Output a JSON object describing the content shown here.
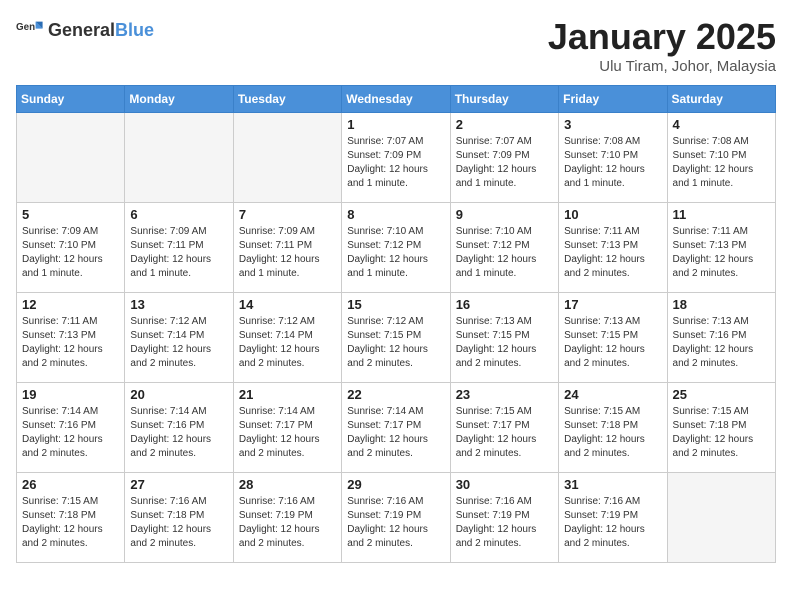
{
  "logo": {
    "text_general": "General",
    "text_blue": "Blue"
  },
  "header": {
    "month_title": "January 2025",
    "location": "Ulu Tiram, Johor, Malaysia"
  },
  "weekdays": [
    "Sunday",
    "Monday",
    "Tuesday",
    "Wednesday",
    "Thursday",
    "Friday",
    "Saturday"
  ],
  "weeks": [
    [
      {
        "day": "",
        "empty": true
      },
      {
        "day": "",
        "empty": true
      },
      {
        "day": "",
        "empty": true
      },
      {
        "day": "1",
        "sunrise": "7:07 AM",
        "sunset": "7:09 PM",
        "daylight": "12 hours and 1 minute."
      },
      {
        "day": "2",
        "sunrise": "7:07 AM",
        "sunset": "7:09 PM",
        "daylight": "12 hours and 1 minute."
      },
      {
        "day": "3",
        "sunrise": "7:08 AM",
        "sunset": "7:10 PM",
        "daylight": "12 hours and 1 minute."
      },
      {
        "day": "4",
        "sunrise": "7:08 AM",
        "sunset": "7:10 PM",
        "daylight": "12 hours and 1 minute."
      }
    ],
    [
      {
        "day": "5",
        "sunrise": "7:09 AM",
        "sunset": "7:10 PM",
        "daylight": "12 hours and 1 minute."
      },
      {
        "day": "6",
        "sunrise": "7:09 AM",
        "sunset": "7:11 PM",
        "daylight": "12 hours and 1 minute."
      },
      {
        "day": "7",
        "sunrise": "7:09 AM",
        "sunset": "7:11 PM",
        "daylight": "12 hours and 1 minute."
      },
      {
        "day": "8",
        "sunrise": "7:10 AM",
        "sunset": "7:12 PM",
        "daylight": "12 hours and 1 minute."
      },
      {
        "day": "9",
        "sunrise": "7:10 AM",
        "sunset": "7:12 PM",
        "daylight": "12 hours and 1 minute."
      },
      {
        "day": "10",
        "sunrise": "7:11 AM",
        "sunset": "7:13 PM",
        "daylight": "12 hours and 2 minutes."
      },
      {
        "day": "11",
        "sunrise": "7:11 AM",
        "sunset": "7:13 PM",
        "daylight": "12 hours and 2 minutes."
      }
    ],
    [
      {
        "day": "12",
        "sunrise": "7:11 AM",
        "sunset": "7:13 PM",
        "daylight": "12 hours and 2 minutes."
      },
      {
        "day": "13",
        "sunrise": "7:12 AM",
        "sunset": "7:14 PM",
        "daylight": "12 hours and 2 minutes."
      },
      {
        "day": "14",
        "sunrise": "7:12 AM",
        "sunset": "7:14 PM",
        "daylight": "12 hours and 2 minutes."
      },
      {
        "day": "15",
        "sunrise": "7:12 AM",
        "sunset": "7:15 PM",
        "daylight": "12 hours and 2 minutes."
      },
      {
        "day": "16",
        "sunrise": "7:13 AM",
        "sunset": "7:15 PM",
        "daylight": "12 hours and 2 minutes."
      },
      {
        "day": "17",
        "sunrise": "7:13 AM",
        "sunset": "7:15 PM",
        "daylight": "12 hours and 2 minutes."
      },
      {
        "day": "18",
        "sunrise": "7:13 AM",
        "sunset": "7:16 PM",
        "daylight": "12 hours and 2 minutes."
      }
    ],
    [
      {
        "day": "19",
        "sunrise": "7:14 AM",
        "sunset": "7:16 PM",
        "daylight": "12 hours and 2 minutes."
      },
      {
        "day": "20",
        "sunrise": "7:14 AM",
        "sunset": "7:16 PM",
        "daylight": "12 hours and 2 minutes."
      },
      {
        "day": "21",
        "sunrise": "7:14 AM",
        "sunset": "7:17 PM",
        "daylight": "12 hours and 2 minutes."
      },
      {
        "day": "22",
        "sunrise": "7:14 AM",
        "sunset": "7:17 PM",
        "daylight": "12 hours and 2 minutes."
      },
      {
        "day": "23",
        "sunrise": "7:15 AM",
        "sunset": "7:17 PM",
        "daylight": "12 hours and 2 minutes."
      },
      {
        "day": "24",
        "sunrise": "7:15 AM",
        "sunset": "7:18 PM",
        "daylight": "12 hours and 2 minutes."
      },
      {
        "day": "25",
        "sunrise": "7:15 AM",
        "sunset": "7:18 PM",
        "daylight": "12 hours and 2 minutes."
      }
    ],
    [
      {
        "day": "26",
        "sunrise": "7:15 AM",
        "sunset": "7:18 PM",
        "daylight": "12 hours and 2 minutes."
      },
      {
        "day": "27",
        "sunrise": "7:16 AM",
        "sunset": "7:18 PM",
        "daylight": "12 hours and 2 minutes."
      },
      {
        "day": "28",
        "sunrise": "7:16 AM",
        "sunset": "7:19 PM",
        "daylight": "12 hours and 2 minutes."
      },
      {
        "day": "29",
        "sunrise": "7:16 AM",
        "sunset": "7:19 PM",
        "daylight": "12 hours and 2 minutes."
      },
      {
        "day": "30",
        "sunrise": "7:16 AM",
        "sunset": "7:19 PM",
        "daylight": "12 hours and 2 minutes."
      },
      {
        "day": "31",
        "sunrise": "7:16 AM",
        "sunset": "7:19 PM",
        "daylight": "12 hours and 2 minutes."
      },
      {
        "day": "",
        "empty": true
      }
    ]
  ],
  "labels": {
    "sunrise": "Sunrise:",
    "sunset": "Sunset:",
    "daylight": "Daylight:"
  }
}
